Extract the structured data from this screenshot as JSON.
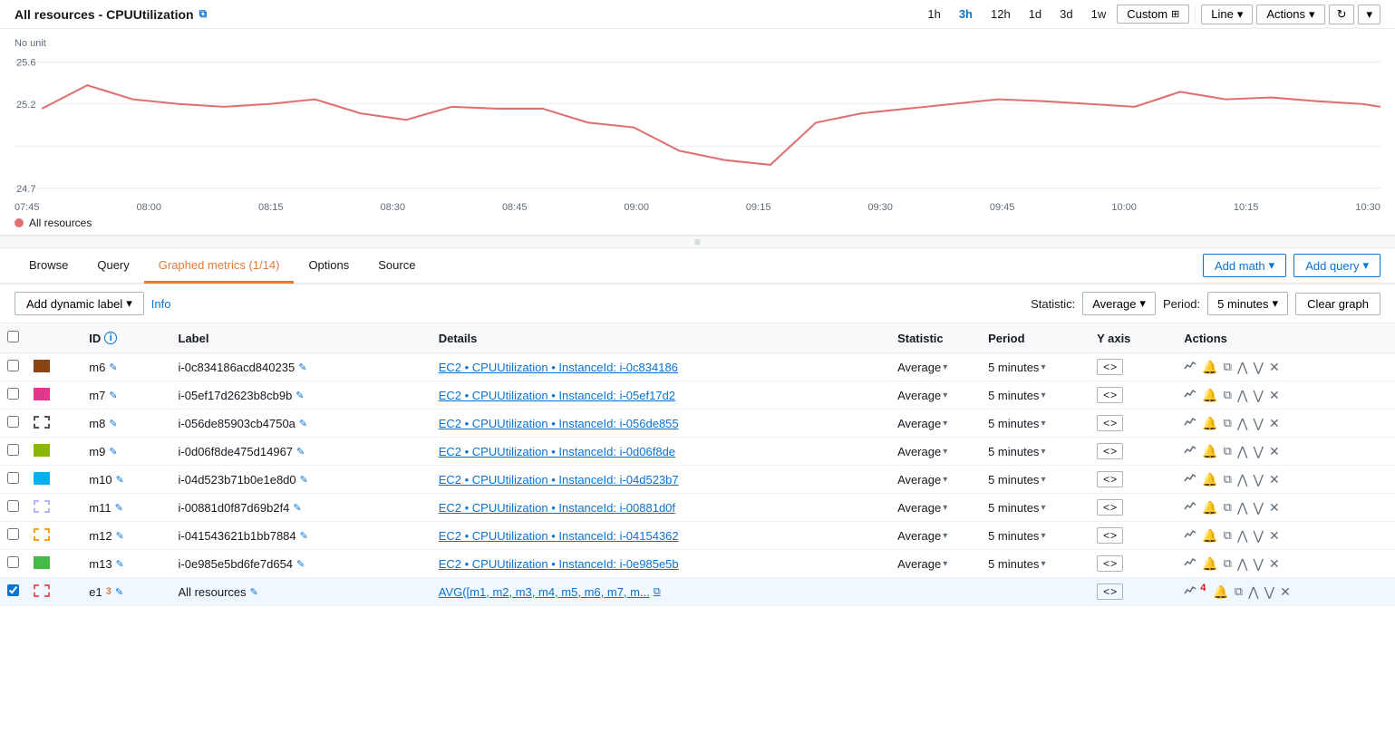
{
  "header": {
    "title": "All resources - CPUUtilization",
    "ext_icon": "⧉",
    "time_options": [
      "1h",
      "3h",
      "12h",
      "1d",
      "3d",
      "1w"
    ],
    "active_time": "3h",
    "custom_label": "Custom",
    "custom_icon": "⊞",
    "chart_type_label": "Line",
    "actions_label": "Actions",
    "refresh_icon": "↻",
    "more_icon": "▾"
  },
  "chart": {
    "y_label": "No unit",
    "y_values": [
      "25.6",
      "25.2",
      "24.7"
    ],
    "x_labels": [
      "07:45",
      "08:00",
      "08:15",
      "08:30",
      "08:45",
      "09:00",
      "09:15",
      "09:30",
      "09:45",
      "10:00",
      "10:15",
      "10:30"
    ],
    "legend_label": "All resources",
    "legend_color": "#e07070"
  },
  "tabs": {
    "items": [
      {
        "label": "Browse",
        "active": false
      },
      {
        "label": "Query",
        "active": false
      },
      {
        "label": "Graphed metrics (1/14)",
        "active": true
      },
      {
        "label": "Options",
        "active": false
      },
      {
        "label": "Source",
        "active": false
      }
    ],
    "add_math_label": "Add math",
    "add_query_label": "Add query"
  },
  "toolbar": {
    "dynamic_label": "Add dynamic label",
    "info_label": "Info",
    "statistic_label": "Statistic:",
    "statistic_value": "Average",
    "period_label": "Period:",
    "period_value": "5 minutes",
    "clear_graph_label": "Clear graph"
  },
  "table": {
    "columns": [
      "",
      "",
      "ID",
      "Label",
      "Details",
      "Statistic",
      "Period",
      "Y axis",
      "Actions"
    ],
    "rows": [
      {
        "id": "m6",
        "label": "i-0c834186acd840235",
        "details": "EC2 • CPUUtilization • InstanceId: i-0c834186",
        "statistic": "Average",
        "period": "5 minutes",
        "color": "#8B4513",
        "dashed": false,
        "checked": false
      },
      {
        "id": "m7",
        "label": "i-05ef17d2623b8cb9b",
        "details": "EC2 • CPUUtilization • InstanceId: i-05ef17d2",
        "statistic": "Average",
        "period": "5 minutes",
        "color": "#e0388c",
        "dashed": false,
        "checked": false
      },
      {
        "id": "m8",
        "label": "i-056de85903cb4750a",
        "details": "EC2 • CPUUtilization • InstanceId: i-056de855",
        "statistic": "Average",
        "period": "5 minutes",
        "color": "#555555",
        "dashed": true,
        "checked": false
      },
      {
        "id": "m9",
        "label": "i-0d06f8de475d14967",
        "details": "EC2 • CPUUtilization • InstanceId: i-0d06f8de",
        "statistic": "Average",
        "period": "5 minutes",
        "color": "#8db600",
        "dashed": false,
        "checked": false
      },
      {
        "id": "m10",
        "label": "i-04d523b71b0e1e8d0",
        "details": "EC2 • CPUUtilization • InstanceId: i-04d523b7",
        "statistic": "Average",
        "period": "5 minutes",
        "color": "#00b0f0",
        "dashed": false,
        "checked": false
      },
      {
        "id": "m11",
        "label": "i-00881d0f87d69b2f4",
        "details": "EC2 • CPUUtilization • InstanceId: i-00881d0f",
        "statistic": "Average",
        "period": "5 minutes",
        "color": "#b0b8f8",
        "dashed": true,
        "checked": false
      },
      {
        "id": "m12",
        "label": "i-041543621b1bb7884",
        "details": "EC2 • CPUUtilization • InstanceId: i-04154362",
        "statistic": "Average",
        "period": "5 minutes",
        "color": "#f4a020",
        "dashed": true,
        "checked": false
      },
      {
        "id": "m13",
        "label": "i-0e985e5bd6fe7d654",
        "details": "EC2 • CPUUtilization • InstanceId: i-0e985e5b",
        "statistic": "Average",
        "period": "5 minutes",
        "color": "#44bb44",
        "dashed": false,
        "checked": false
      },
      {
        "id": "e1",
        "label": "All resources",
        "details": "AVG([m1, m2, m3, m4, m5, m6, m7, m...",
        "statistic": "",
        "period": "",
        "color": "#e06060",
        "dashed": true,
        "checked": true,
        "is_expression": true,
        "badge": "3",
        "action_badge": "4"
      }
    ]
  }
}
